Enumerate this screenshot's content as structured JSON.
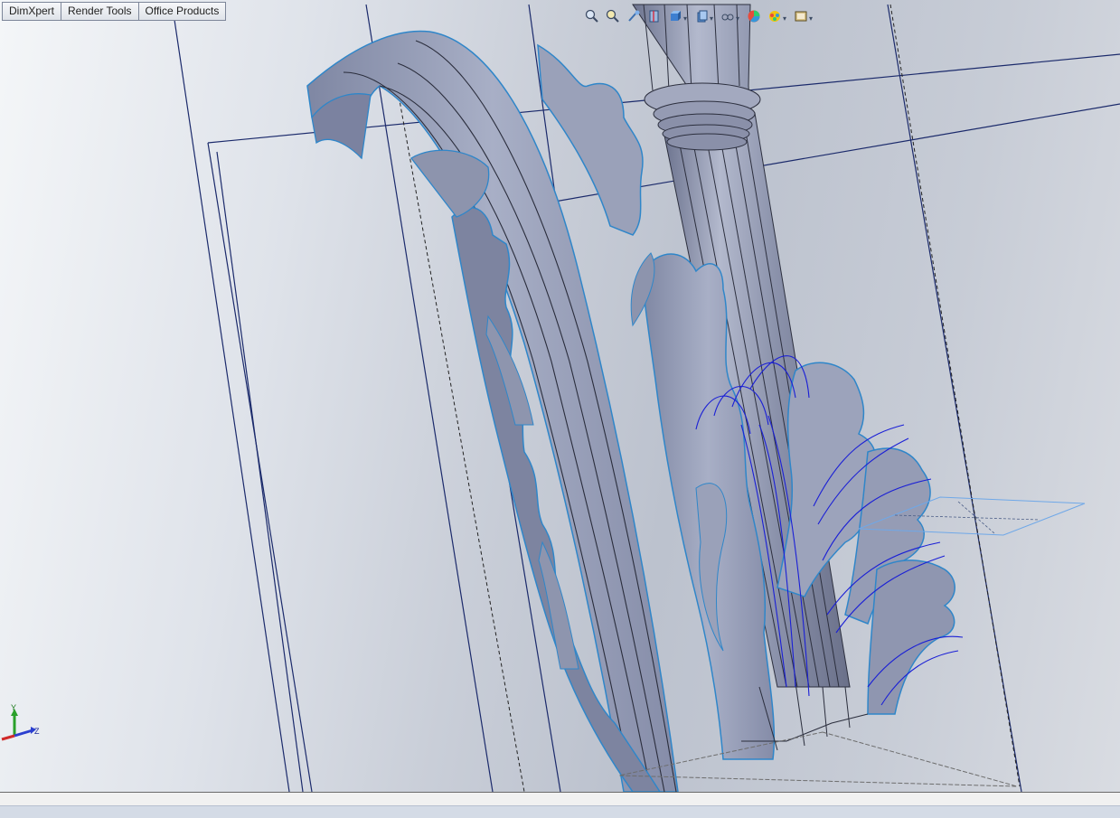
{
  "tabs": [
    "DimXpert",
    "Render Tools",
    "Office Products"
  ],
  "heads_up_toolbar": [
    {
      "icon": "zoom-to-fit-icon"
    },
    {
      "icon": "zoom-to-area-icon"
    },
    {
      "icon": "previous-view-icon"
    },
    {
      "icon": "section-view-icon"
    },
    {
      "icon": "view-orientation-icon",
      "dropdown": true
    },
    {
      "icon": "display-style-icon",
      "dropdown": true
    },
    {
      "icon": "hide-show-items-icon",
      "dropdown": true
    },
    {
      "icon": "edit-appearance-icon"
    },
    {
      "icon": "apply-scene-icon",
      "dropdown": true
    },
    {
      "icon": "view-settings-icon",
      "dropdown": true
    }
  ],
  "triad": {
    "y_label": "Y",
    "z_label": "Z"
  },
  "colors": {
    "plane_line": "#1b2a6b",
    "model_fill": "#8f96b0",
    "selected_edge": "#2f86c9",
    "sketch_curve": "#1a1fd6"
  }
}
